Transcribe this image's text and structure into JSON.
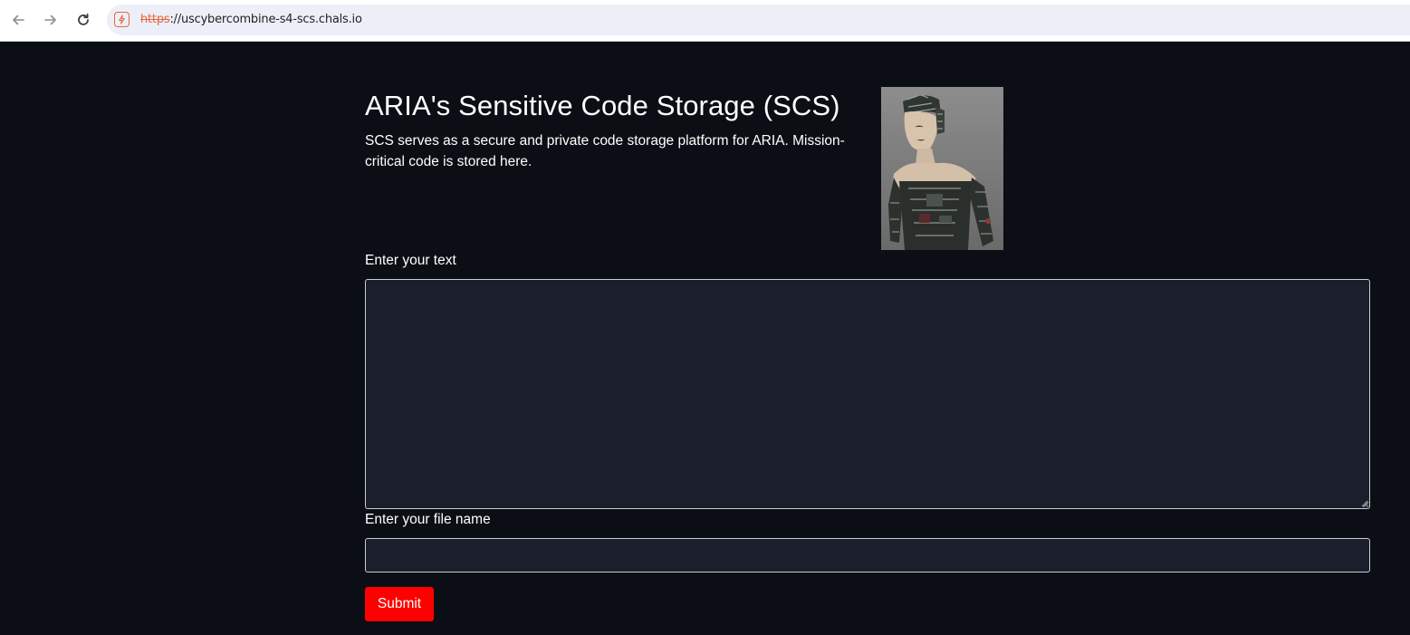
{
  "browser": {
    "url_scheme": "https",
    "url_rest": "://uscybercombine-s4-scs.chals.io",
    "icons": {
      "back": "arrow-left-icon",
      "forward": "arrow-right-icon",
      "reload": "reload-icon",
      "site_info": "insecure-site-icon"
    }
  },
  "page": {
    "title": "ARIA's Sensitive Code Storage (SCS)",
    "description": "SCS serves as a secure and private code storage platform for ARIA. Mission-critical code is stored here.",
    "hero_image": "robot-image"
  },
  "form": {
    "text_label": "Enter your text",
    "text_value": "",
    "file_label": "Enter your file name",
    "file_value": "",
    "submit_label": "Submit"
  },
  "colors": {
    "background": "#0b0e15",
    "input_background": "#1a1f2b",
    "submit": "#ff0000",
    "insecure_accent": "#e8663e"
  }
}
